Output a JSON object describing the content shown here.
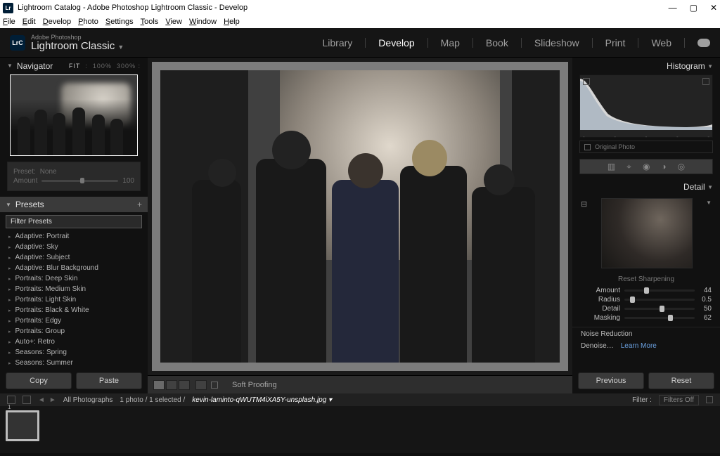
{
  "window": {
    "title": "Lightroom Catalog - Adobe Photoshop Lightroom Classic - Develop",
    "app_short": "Lr"
  },
  "menu": [
    "File",
    "Edit",
    "Develop",
    "Photo",
    "Settings",
    "Tools",
    "View",
    "Window",
    "Help"
  ],
  "identity": {
    "logo": "LrC",
    "line1": "Adobe Photoshop",
    "line2": "Lightroom Classic"
  },
  "modules": {
    "items": [
      "Library",
      "Develop",
      "Map",
      "Book",
      "Slideshow",
      "Print",
      "Web"
    ],
    "active": "Develop"
  },
  "navigator": {
    "title": "Navigator",
    "fit_label": "FIT",
    "zoom1": "100%",
    "zoom2": "300%"
  },
  "preset_preview": {
    "preset_label": "Preset:",
    "preset_value": "None",
    "amount_label": "Amount",
    "amount_value": "100"
  },
  "presets": {
    "title": "Presets",
    "filter_placeholder": "Filter Presets",
    "items": [
      "Adaptive: Portrait",
      "Adaptive: Sky",
      "Adaptive: Subject",
      "Adaptive: Blur Background",
      "Portraits: Deep Skin",
      "Portraits: Medium Skin",
      "Portraits: Light Skin",
      "Portraits: Black & White",
      "Portraits: Edgy",
      "Portraits: Group",
      "Auto+: Retro",
      "Seasons: Spring",
      "Seasons: Summer"
    ]
  },
  "left_buttons": {
    "copy": "Copy",
    "paste": "Paste"
  },
  "center": {
    "soft_proofing_label": "Soft Proofing"
  },
  "histogram": {
    "title": "Histogram",
    "original_label": "Original Photo"
  },
  "detail": {
    "title": "Detail",
    "section_label": "Reset Sharpening",
    "sliders": [
      {
        "label": "Amount",
        "value": 44,
        "pos": 28
      },
      {
        "label": "Radius",
        "value": "0.5",
        "pos": 8
      },
      {
        "label": "Detail",
        "value": 50,
        "pos": 50
      },
      {
        "label": "Masking",
        "value": 62,
        "pos": 62
      }
    ],
    "noise_label": "Noise Reduction",
    "denoise_label": "Denoise…",
    "learn_more": "Learn More"
  },
  "right_buttons": {
    "previous": "Previous",
    "reset": "Reset"
  },
  "filmstrip": {
    "source": "All Photographs",
    "count": "1 photo / 1 selected /",
    "filename": "kevin-laminto-qWUTM4iXA5Y-unsplash.jpg",
    "filter_label": "Filter :",
    "filter_value": "Filters Off",
    "thumb_index": "1"
  }
}
